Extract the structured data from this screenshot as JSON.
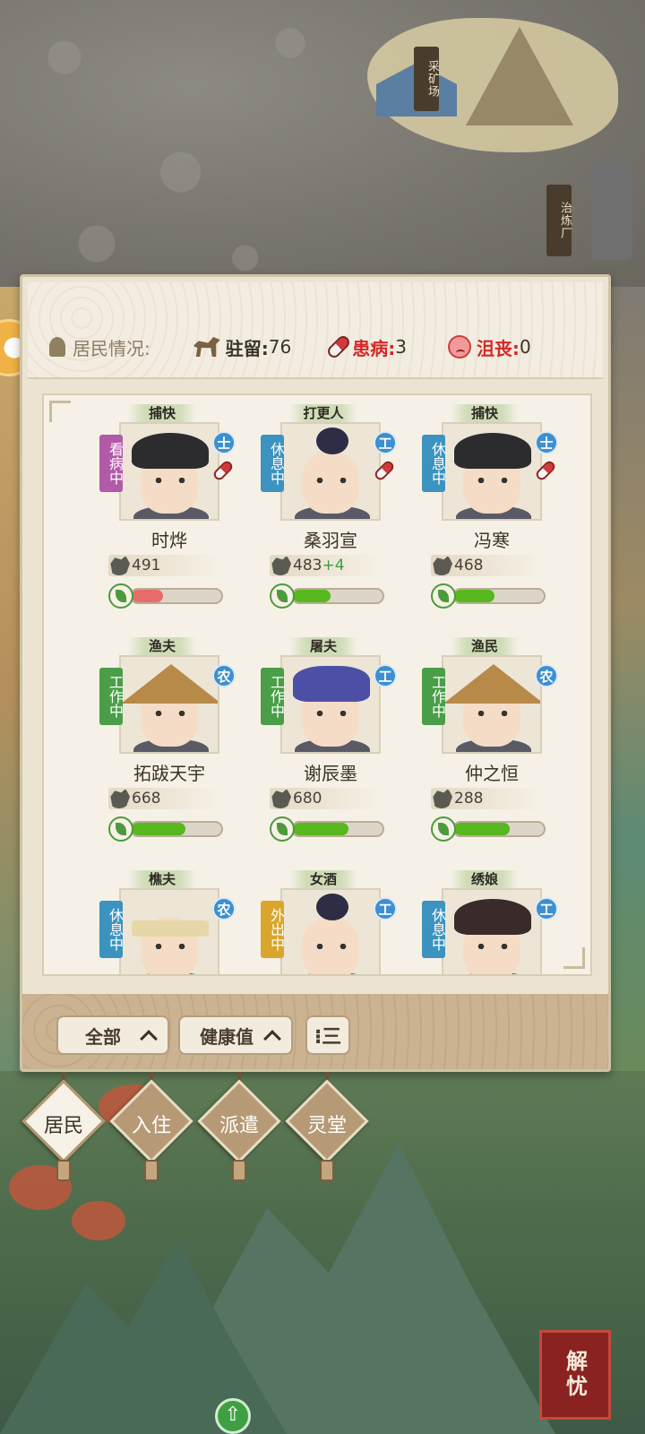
{
  "map": {
    "mine_sign": "采矿场",
    "forge_sign": "治炼厂"
  },
  "panel": {
    "status": {
      "label": "居民情况:",
      "stationed_label": "驻留:",
      "stationed_value": "76",
      "sick_label": "患病:",
      "sick_value": "3",
      "depressed_label": "沮丧:",
      "depressed_value": "0"
    },
    "residents": [
      {
        "role": "捕快",
        "status": "看病中",
        "class": "士",
        "name": "时烨",
        "power": "491",
        "power_bonus": "",
        "health": 0.35,
        "health_color": "red",
        "sick": true
      },
      {
        "role": "打更人",
        "status": "休息中",
        "class": "工",
        "name": "桑羽宣",
        "power": "483",
        "power_bonus": "+4",
        "health": 0.42,
        "health_color": "green",
        "sick": true
      },
      {
        "role": "捕快",
        "status": "休息中",
        "class": "士",
        "name": "冯寒",
        "power": "468",
        "power_bonus": "",
        "health": 0.45,
        "health_color": "green",
        "sick": true
      },
      {
        "role": "渔夫",
        "status": "工作中",
        "class": "农",
        "name": "拓跋天宇",
        "power": "668",
        "power_bonus": "",
        "health": 0.6,
        "health_color": "green",
        "sick": false
      },
      {
        "role": "屠夫",
        "status": "工作中",
        "class": "工",
        "name": "谢辰墨",
        "power": "680",
        "power_bonus": "",
        "health": 0.62,
        "health_color": "green",
        "sick": false
      },
      {
        "role": "渔民",
        "status": "工作中",
        "class": "农",
        "name": "仲之恒",
        "power": "288",
        "power_bonus": "",
        "health": 0.62,
        "health_color": "green",
        "sick": false
      },
      {
        "role": "樵夫",
        "status": "休息中",
        "class": "农",
        "name": "",
        "power": "",
        "power_bonus": "",
        "health": 0,
        "health_color": "green",
        "sick": false
      },
      {
        "role": "女酒",
        "status": "外出中",
        "class": "工",
        "name": "",
        "power": "",
        "power_bonus": "",
        "health": 0,
        "health_color": "green",
        "sick": false
      },
      {
        "role": "绣娘",
        "status": "休息中",
        "class": "工",
        "name": "",
        "power": "",
        "power_bonus": "",
        "health": 0,
        "health_color": "green",
        "sick": false
      }
    ],
    "footer": {
      "filter_all": "全部",
      "sort_health": "健康值",
      "order_icon": "⁝三"
    }
  },
  "tabs": [
    {
      "label": "居民",
      "active": true
    },
    {
      "label": "入住",
      "active": false
    },
    {
      "label": "派遣",
      "active": false
    },
    {
      "label": "灵堂",
      "active": false
    }
  ],
  "corner_button": "解忧",
  "colors": {
    "sick_status": "#b05aa8",
    "rest_status": "#3c93bf",
    "work_status": "#4a9e48",
    "out_status": "#d9a52c",
    "health_red": "#e86b6b",
    "health_green": "#56b81e",
    "alert_red": "#d42828"
  }
}
